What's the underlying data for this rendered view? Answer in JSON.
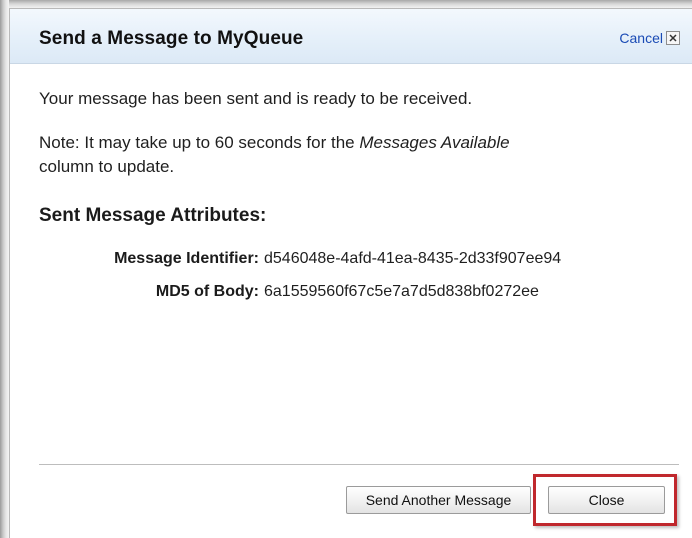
{
  "dialog": {
    "title": "Send a Message to MyQueue",
    "cancel_label": "Cancel"
  },
  "content": {
    "sent_message": "Your message has been sent and is ready to be received.",
    "note_prefix": "Note: It may take up to 60 seconds for the ",
    "note_emphasis": "Messages Available",
    "note_line2": "column to update.",
    "attributes_heading": "Sent Message Attributes:"
  },
  "attributes": [
    {
      "label": "Message Identifier:",
      "value": "d546048e-4afd-41ea-8435-2d33f907ee94"
    },
    {
      "label": "MD5 of Body:",
      "value": "6a1559560f67c5e7a7d5d838bf0272ee"
    }
  ],
  "footer": {
    "send_another_label": "Send Another Message",
    "close_label": "Close"
  },
  "icons": {
    "cancel_close": "close-x-icon"
  },
  "colors": {
    "title_bar": "#e4eff9",
    "link": "#1a4bb5",
    "highlight": "#c0282d"
  }
}
